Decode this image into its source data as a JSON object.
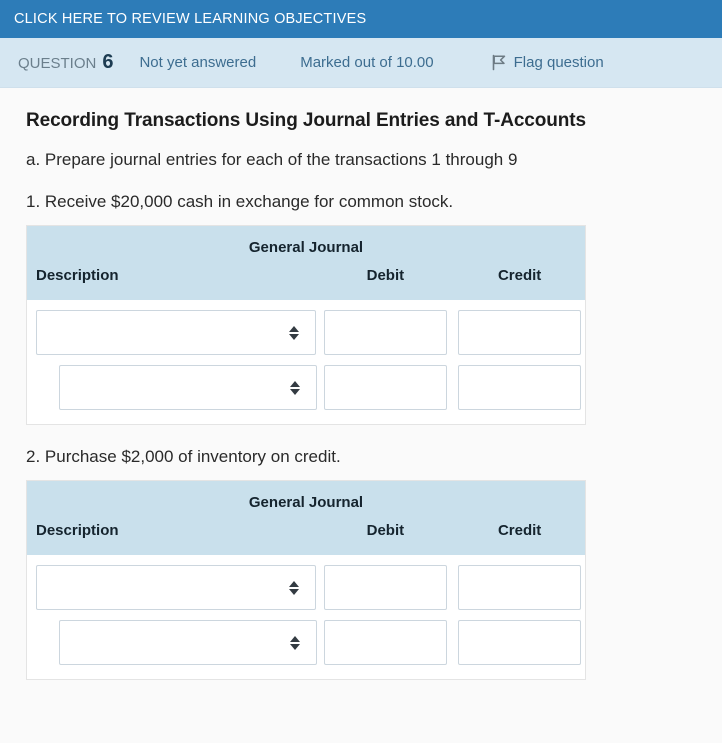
{
  "banner": {
    "link_label": "CLICK HERE TO REVIEW LEARNING OBJECTIVES",
    "background_color": "#2d7cb8"
  },
  "question_bar": {
    "question_word": "QUESTION",
    "question_number": "6",
    "state": "Not yet answered",
    "marks": "Marked out of 10.00",
    "flag_label": "Flag question",
    "flag_icon": "flag-icon",
    "background_color": "#d6e7f2"
  },
  "question": {
    "title": "Recording Transactions Using Journal Entries and T-Accounts",
    "instruction": "a. Prepare journal entries for each of the transactions 1 through 9"
  },
  "table_labels": {
    "journal_title": "General Journal",
    "description": "Description",
    "debit": "Debit",
    "credit": "Credit",
    "select_icon": "sort-arrows-icon",
    "header_color": "#c9e0ec"
  },
  "transactions": [
    {
      "label": "1. Receive $20,000 cash in exchange for common stock.",
      "rows": [
        {
          "account": "",
          "debit": "",
          "credit": "",
          "indented": false
        },
        {
          "account": "",
          "debit": "",
          "credit": "",
          "indented": true
        }
      ]
    },
    {
      "label": "2. Purchase $2,000 of inventory on credit.",
      "rows": [
        {
          "account": "",
          "debit": "",
          "credit": "",
          "indented": false
        },
        {
          "account": "",
          "debit": "",
          "credit": "",
          "indented": true
        }
      ]
    }
  ]
}
